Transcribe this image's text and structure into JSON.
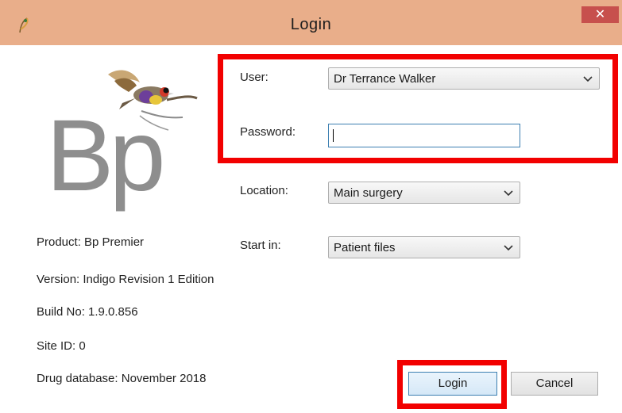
{
  "window": {
    "title": "Login",
    "close_glyph": "✕",
    "app_icon": "feather-icon"
  },
  "logo": {
    "text": "Bp",
    "icon": "finch-bird-icon"
  },
  "product_info": {
    "product": "Product: Bp Premier",
    "version": "Version: Indigo Revision 1 Edition",
    "build": "Build No: 1.9.0.856",
    "site_id": "Site ID: 0",
    "drug_database": "Drug database: November 2018"
  },
  "form": {
    "user": {
      "label": "User:",
      "value": "Dr Terrance Walker"
    },
    "password": {
      "label": "Password:",
      "value": ""
    },
    "location": {
      "label": "Location:",
      "value": "Main surgery"
    },
    "start_in": {
      "label": "Start in:",
      "value": "Patient files"
    }
  },
  "buttons": {
    "login": "Login",
    "cancel": "Cancel"
  },
  "colors": {
    "titlebar": "#e9ae8a",
    "close_button": "#c7504d",
    "highlight": "#f20000",
    "focus_border": "#3c7fb1",
    "logo_gray": "#8e8e8e"
  }
}
